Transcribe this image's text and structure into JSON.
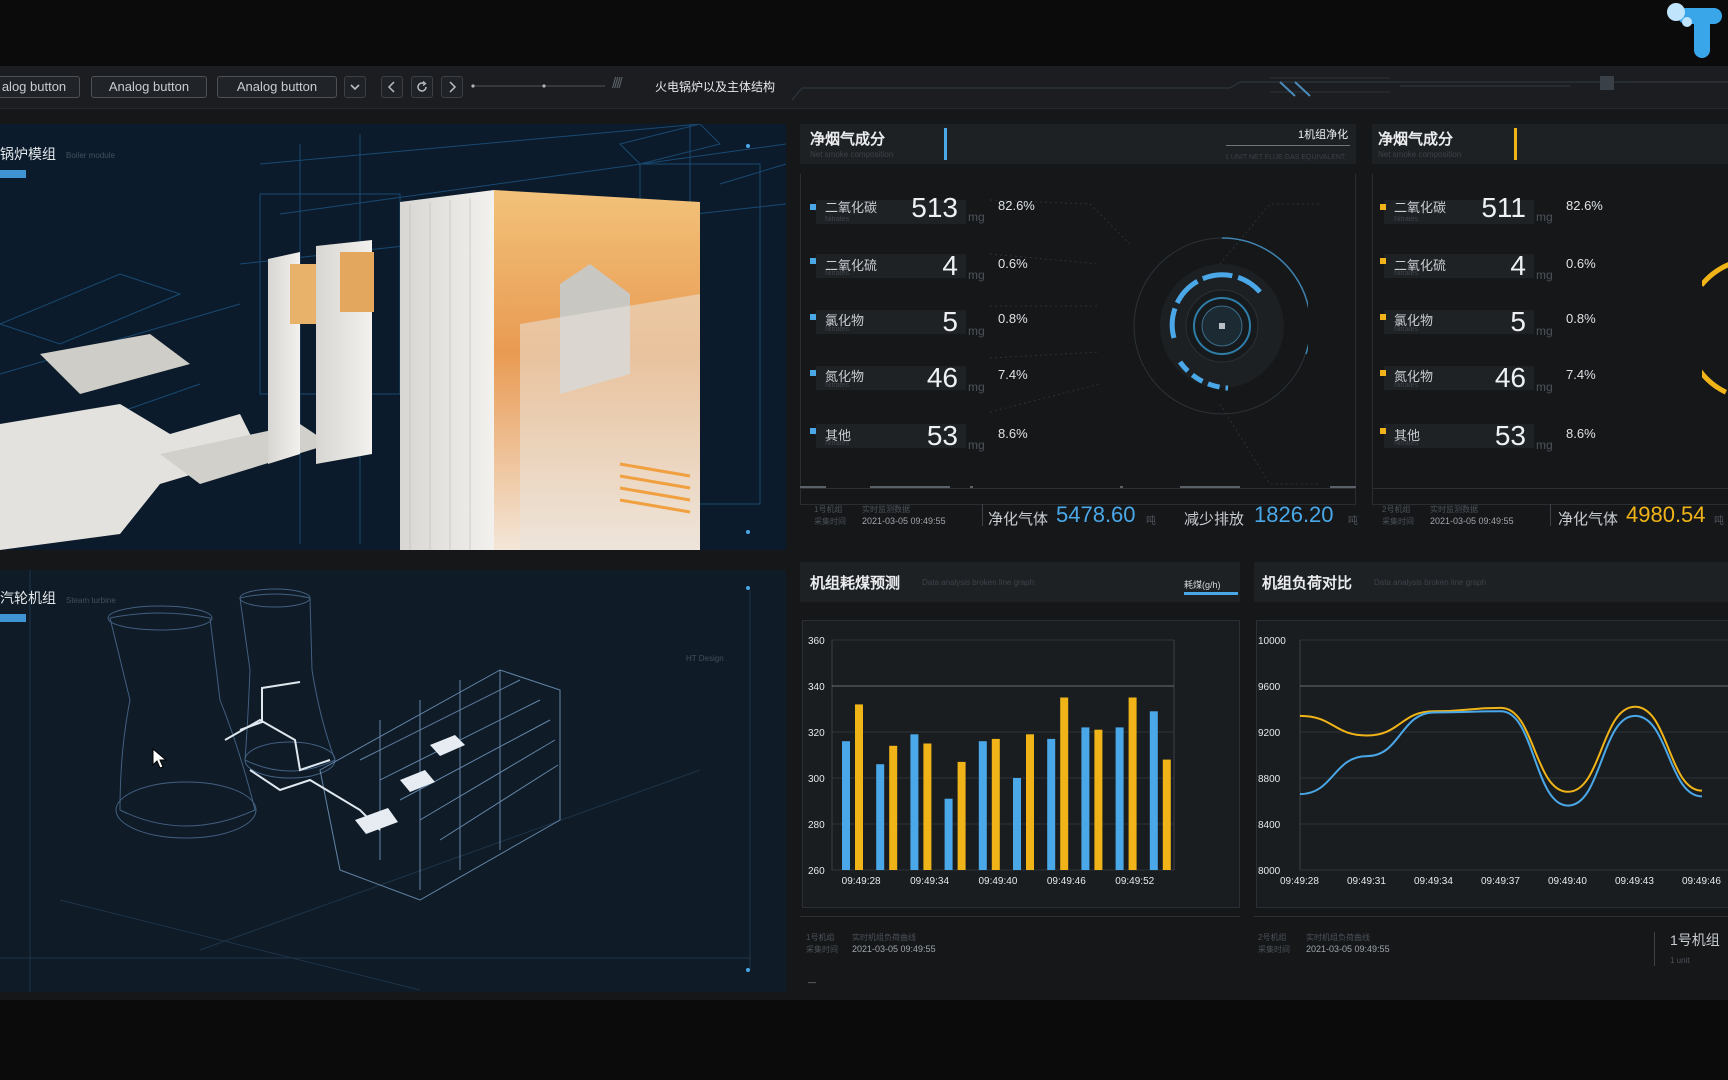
{
  "toolbar": {
    "buttons": [
      "alog button",
      "Analog button",
      "Analog button"
    ],
    "title": "火电锅炉以及主体结构"
  },
  "boiler_panel": {
    "title": "锅炉模组",
    "subtitle": "Boiler module"
  },
  "turbine_panel": {
    "title": "汽轮机组",
    "subtitle": "Steam turbine",
    "tag": "HT Design"
  },
  "flue_gas_left": {
    "title": "净烟气成分",
    "subtitle": "Net smoke composition",
    "badge": "1机组净化",
    "badge_sub": "1 UNIT NET FLUE GAS EQUIVALENT",
    "accent": "#4aa8e8",
    "rows": [
      {
        "label": "二氧化碳",
        "sub": "Nitrates",
        "value": "513",
        "unit": "mg",
        "pct": "82.6%"
      },
      {
        "label": "二氧化硫",
        "sub": "Nitrates",
        "value": "4",
        "unit": "mg",
        "pct": "0.6%"
      },
      {
        "label": "氯化物",
        "sub": "Nitrates",
        "value": "5",
        "unit": "mg",
        "pct": "0.8%"
      },
      {
        "label": "氮化物",
        "sub": "Nitrates",
        "value": "46",
        "unit": "mg",
        "pct": "7.4%"
      },
      {
        "label": "其他",
        "sub": "Nitrates",
        "value": "53",
        "unit": "mg",
        "pct": "8.6%"
      }
    ],
    "footer": {
      "small1": "1号机组",
      "small2": "采集时间",
      "small3": "实时监测数据",
      "time": "2021-03-05 09:49:55",
      "label1": "净化气体",
      "value1": "5478.60",
      "unit1": "吨",
      "label2": "减少排放",
      "value2": "1826.20",
      "unit2": "吨"
    }
  },
  "flue_gas_right": {
    "title": "净烟气成分",
    "subtitle": "Net smoke composition",
    "accent": "#f0b418",
    "rows": [
      {
        "label": "二氧化碳",
        "sub": "Nitrates",
        "value": "511",
        "unit": "mg",
        "pct": "82.6%"
      },
      {
        "label": "二氧化硫",
        "sub": "Nitrates",
        "value": "4",
        "unit": "mg",
        "pct": "0.6%"
      },
      {
        "label": "氯化物",
        "sub": "Nitrates",
        "value": "5",
        "unit": "mg",
        "pct": "0.8%"
      },
      {
        "label": "氮化物",
        "sub": "Nitrates",
        "value": "46",
        "unit": "mg",
        "pct": "7.4%"
      },
      {
        "label": "其他",
        "sub": "Nitrates",
        "value": "53",
        "unit": "mg",
        "pct": "8.6%"
      }
    ],
    "footer": {
      "small1": "2号机组",
      "small2": "采集时间",
      "small3": "实时监测数据",
      "time": "2021-03-05 09:49:55",
      "label1": "净化气体",
      "value1": "4980.54",
      "unit1": "吨"
    }
  },
  "coal_chart": {
    "title": "机组耗煤预测",
    "subtitle": "Data analysis broken line graph",
    "legend": "耗煤(g/h)",
    "footer_small1": "1号机组",
    "footer_small2": "采集时间",
    "footer_small3": "实时机组负荷曲线",
    "footer_time": "2021-03-05 09:49:55",
    "footer_note": "—"
  },
  "load_chart": {
    "title": "机组负荷对比",
    "subtitle": "Data analysis broken line graph",
    "footer_small1": "2号机组",
    "footer_small2": "采集时间",
    "footer_small3": "实时机组负荷曲线",
    "footer_time": "2021-03-05 09:49:55",
    "unit_label": "1号机组",
    "unit_sub": "1 unit"
  },
  "chart_data": [
    {
      "type": "bar",
      "title": "机组耗煤预测",
      "x_ticks": [
        "09:49:28",
        "09:49:34",
        "09:49:40",
        "09:49:46",
        "09:49:52"
      ],
      "ylim": [
        260,
        360
      ],
      "y_ticks": [
        260,
        280,
        300,
        320,
        340,
        360
      ],
      "grid": true,
      "series": [
        {
          "color": "#4aa8e8",
          "values": [
            316,
            306,
            319,
            291,
            316,
            300,
            317,
            322,
            322,
            329
          ]
        },
        {
          "color": "#f0b418",
          "values": [
            332,
            314,
            315,
            307,
            317,
            319,
            335,
            321,
            335,
            308
          ]
        }
      ]
    },
    {
      "type": "line",
      "title": "机组负荷对比",
      "x_ticks": [
        "09:49:28",
        "09:49:31",
        "09:49:34",
        "09:49:37",
        "09:49:40",
        "09:49:43",
        "09:49:46"
      ],
      "ylim": [
        8000,
        10000
      ],
      "y_ticks": [
        8000,
        8400,
        8800,
        9200,
        9600,
        10000
      ],
      "grid": true,
      "series": [
        {
          "color": "#f0b418",
          "values": [
            9340,
            9170,
            9380,
            9410,
            8680,
            9420,
            8690
          ]
        },
        {
          "color": "#4aa8e8",
          "values": [
            8660,
            8990,
            9370,
            9380,
            8560,
            9340,
            8640
          ]
        }
      ]
    }
  ]
}
